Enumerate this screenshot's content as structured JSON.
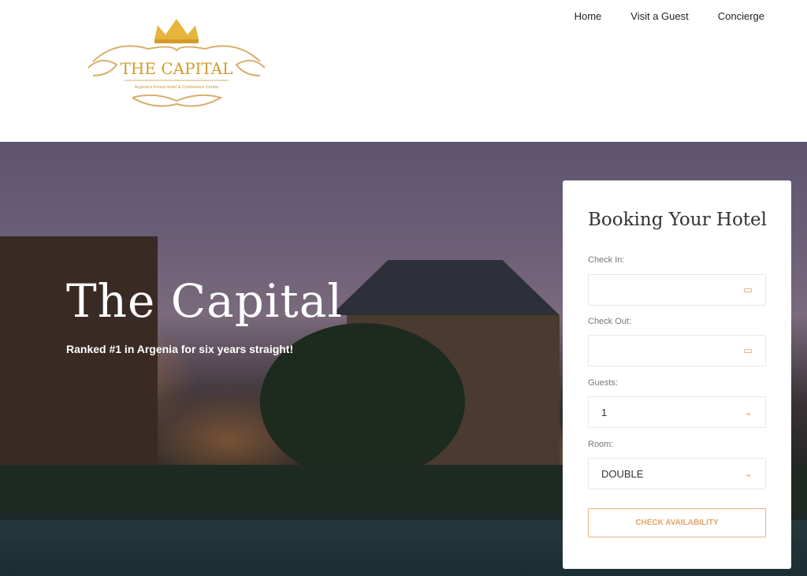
{
  "nav": {
    "items": [
      "Home",
      "Visit a Guest",
      "Concierge"
    ]
  },
  "logo": {
    "title": "THE CAPITAL",
    "subtitle": "Argenia's Finest Hotel & Conference Centre"
  },
  "hero": {
    "title": "The Capital",
    "tagline": "Ranked #1 in Argenia for six years straight!"
  },
  "booking": {
    "title": "Booking Your Hotel",
    "check_in_label": "Check In:",
    "check_in_value": "",
    "check_out_label": "Check Out:",
    "check_out_value": "",
    "guests_label": "Guests:",
    "guests_value": "1",
    "room_label": "Room:",
    "room_value": "DOUBLE",
    "button": "CHECK AVAILABILITY"
  },
  "colors": {
    "accent": "#e2a468",
    "gold": "#d9a63c"
  }
}
